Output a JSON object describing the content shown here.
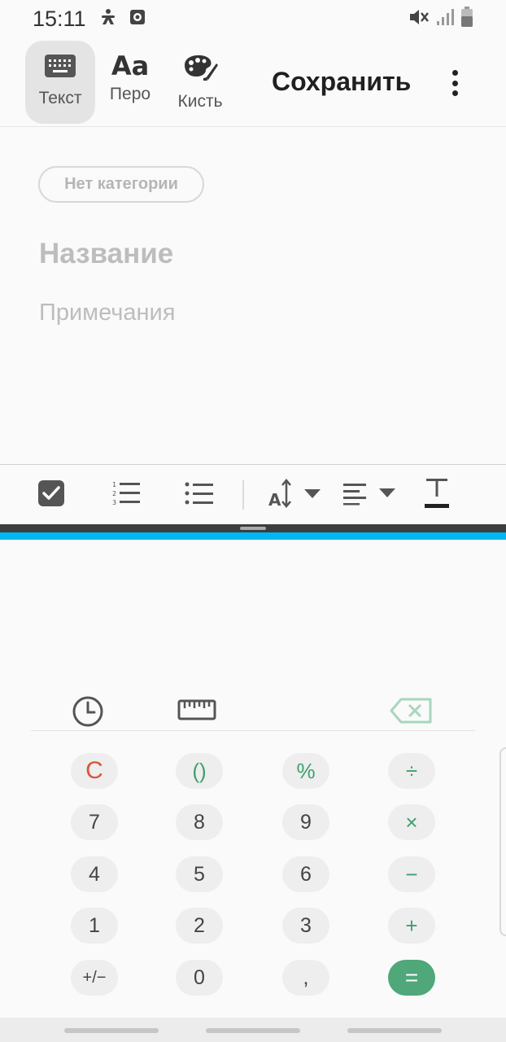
{
  "status_bar": {
    "time": "15:11",
    "left_icons": [
      "accessibility-icon",
      "media-icon"
    ],
    "right_icons": [
      "mute-icon",
      "signal-icon",
      "battery-icon"
    ]
  },
  "toolbar": {
    "modes": [
      {
        "label": "Текст",
        "icon": "keyboard-icon",
        "active": true
      },
      {
        "label": "Перо",
        "icon": "font-aa-icon",
        "active": false
      },
      {
        "label": "Кисть",
        "icon": "palette-brush-icon",
        "active": false
      }
    ],
    "save_label": "Сохранить",
    "more_icon": "more-vertical-icon"
  },
  "note": {
    "category_label": "Нет категории",
    "title_placeholder": "Название",
    "notes_placeholder": "Примечания"
  },
  "format_bar": {
    "tools": [
      "checkbox-icon",
      "numbered-list-icon",
      "bulleted-list-icon",
      "text-size-icon",
      "align-left-icon",
      "text-color-icon"
    ]
  },
  "calculator": {
    "tools": [
      "history-icon",
      "ruler-icon",
      "backspace-icon"
    ],
    "keys": [
      [
        "C",
        "()",
        "%",
        "÷"
      ],
      [
        "7",
        "8",
        "9",
        "×"
      ],
      [
        "4",
        "5",
        "6",
        "−"
      ],
      [
        "1",
        "2",
        "3",
        "+"
      ],
      [
        "+/−",
        "0",
        ",",
        "="
      ]
    ]
  },
  "colors": {
    "accent_blue": "#00b7f1",
    "clear_red": "#d9543b",
    "operator_green": "#3f9f6f",
    "equals_green": "#4fa77a"
  }
}
